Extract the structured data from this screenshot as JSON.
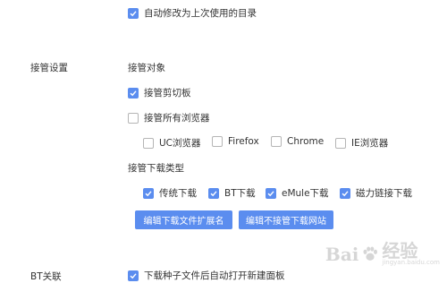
{
  "auto_modify": {
    "label": "自动修改为上次使用的目录",
    "checked": true
  },
  "takeover": {
    "section_label": "接管设置",
    "target_heading": "接管对象",
    "clipboard": {
      "label": "接管剪切板",
      "checked": true
    },
    "all_browsers": {
      "label": "接管所有浏览器",
      "checked": false
    },
    "browsers": [
      {
        "label": "UC浏览器",
        "checked": false
      },
      {
        "label": "Firefox",
        "checked": false
      },
      {
        "label": "Chrome",
        "checked": false
      },
      {
        "label": "IE浏览器",
        "checked": false
      }
    ],
    "download_types_heading": "接管下载类型",
    "download_types": [
      {
        "label": "传统下载",
        "checked": true
      },
      {
        "label": "BT下载",
        "checked": true
      },
      {
        "label": "eMule下载",
        "checked": true
      },
      {
        "label": "磁力链接下载",
        "checked": true
      }
    ],
    "edit_ext_button": "编辑下载文件扩展名",
    "edit_sites_button": "编辑不接管下载网站"
  },
  "bt_section": {
    "label": "BT关联",
    "option": {
      "label": "下载种子文件后自动打开新建面板",
      "checked": true
    }
  },
  "watermark": {
    "brand": "Bai",
    "brand2": "经验",
    "sub": "jingyan.baidu.com"
  }
}
